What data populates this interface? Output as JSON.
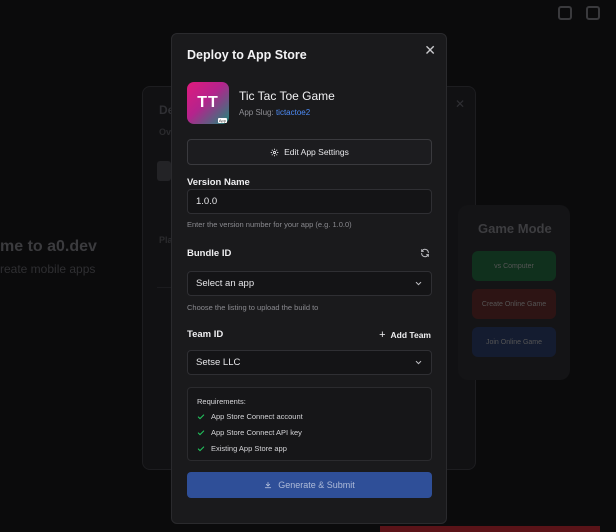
{
  "background": {
    "welcome_text": "me to a0.dev",
    "subtitle": "reate mobile apps",
    "deploy_title": "De",
    "tab_label": "Ov",
    "platform_label": "Pla",
    "game_mode_title": "Game Mode",
    "game_buttons": [
      "vs Computer",
      "Create Online Game",
      "Join Online Game"
    ]
  },
  "modal": {
    "title": "Deploy to App Store",
    "close_icon": "close-icon",
    "app": {
      "icon_text": "TT",
      "icon_badge": "App",
      "name": "Tic Tac Toe Game",
      "slug_label": "App Slug:",
      "slug_value": "tictactoe2"
    },
    "edit_settings_label": "Edit App Settings",
    "version": {
      "label": "Version Name",
      "value": "1.0.0",
      "hint": "Enter the version number for your app (e.g. 1.0.0)"
    },
    "bundle": {
      "label": "Bundle ID",
      "selected": "Select an app",
      "hint": "Choose the listing to upload the build to"
    },
    "team": {
      "label": "Team ID",
      "add_label": "Add Team",
      "selected": "Setse LLC"
    },
    "requirements": {
      "title": "Requirements:",
      "items": [
        "App Store Connect account",
        "App Store Connect API key",
        "Existing App Store app"
      ]
    },
    "submit_label": "Generate & Submit"
  },
  "colors": {
    "accent": "#2f4f98",
    "check": "#22c55e",
    "link": "#4d8bf5"
  }
}
